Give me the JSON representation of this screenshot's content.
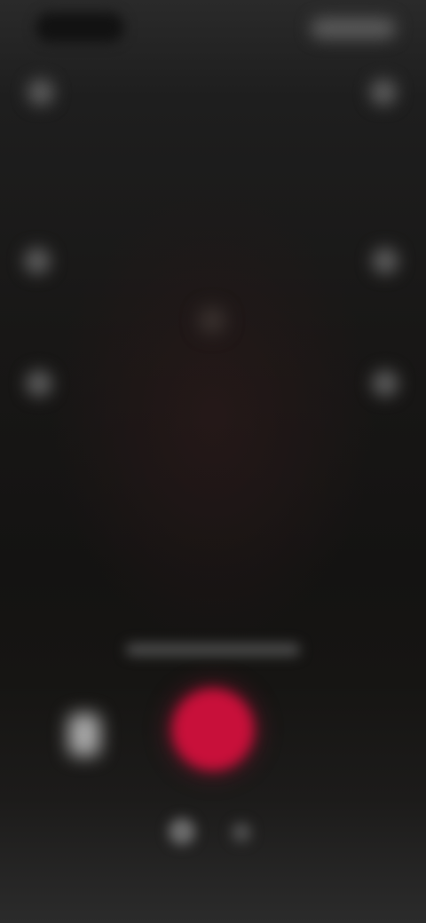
{
  "colors": {
    "background_top": "#2a2a2a",
    "background_mid": "#171615",
    "background_bottom": "#2b2b2b",
    "icon_gray": "#5b5b5b",
    "record_red": "#c8103a",
    "gallery_thumb": "#a8a8a8"
  },
  "status_bar": {
    "time": "",
    "icons": [
      "signal-icon",
      "wifi-icon",
      "battery-icon"
    ]
  },
  "top_controls": {
    "left_icon": "close-icon",
    "right_icon": "settings-icon"
  },
  "side_controls": {
    "left": [
      "flip-camera-icon",
      "speed-icon"
    ],
    "right": [
      "flash-icon",
      "timer-icon"
    ]
  },
  "center_icon": "focus-icon",
  "caption": "",
  "capture": {
    "gallery_icon": "gallery-thumbnail",
    "record_icon": "record-button"
  },
  "mode_selector": [
    "mode-dot-active",
    "mode-dot"
  ]
}
